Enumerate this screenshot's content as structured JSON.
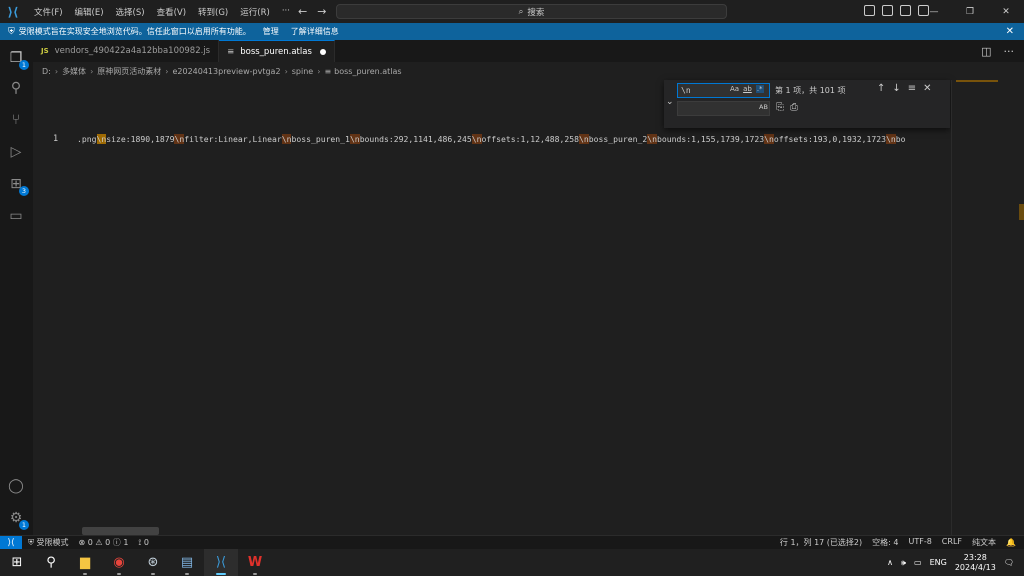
{
  "titlebar": {
    "menu": [
      "文件(F)",
      "编辑(E)",
      "选择(S)",
      "查看(V)",
      "转到(G)",
      "运行(R)",
      "···"
    ],
    "search_placeholder": "搜索"
  },
  "banner": {
    "message": "受限模式旨在实现安全地浏览代码。信任此窗口以启用所有功能。",
    "manage_label": "管理",
    "learn_more_label": "了解详细信息"
  },
  "activity": {
    "explorer_badge": "1",
    "extensions_badge": "3",
    "settings_badge": "1"
  },
  "tabs": [
    {
      "label": "vendors_490422a4a12bba100982.js",
      "type": "JS"
    },
    {
      "label": "boss_puren.atlas",
      "active": true,
      "dirty": true
    }
  ],
  "breadcrumb": [
    "D:",
    "多媒体",
    "原神网页活动素材",
    "e20240413preview-pvtga2",
    "spine",
    "boss_puren.atlas"
  ],
  "editor": {
    "line_number": "1",
    "segments": [
      {
        "t": ".png",
        "h": 0
      },
      {
        "t": "\\n",
        "h": 2
      },
      {
        "t": "size:1890,1879",
        "h": 0
      },
      {
        "t": "\\n",
        "h": 1
      },
      {
        "t": "filter:Linear,Linear",
        "h": 0
      },
      {
        "t": "\\n",
        "h": 1
      },
      {
        "t": "boss_puren_1",
        "h": 0
      },
      {
        "t": "\\n",
        "h": 1
      },
      {
        "t": "bounds:292,1141,486,245",
        "h": 0
      },
      {
        "t": "\\n",
        "h": 1
      },
      {
        "t": "offsets:1,12,488,258",
        "h": 0
      },
      {
        "t": "\\n",
        "h": 1
      },
      {
        "t": "boss_puren_2",
        "h": 0
      },
      {
        "t": "\\n",
        "h": 1
      },
      {
        "t": "bounds:1,155,1739,1723",
        "h": 0
      },
      {
        "t": "\\n",
        "h": 1
      },
      {
        "t": "offsets:193,0,1932,1723",
        "h": 0
      },
      {
        "t": "\\n",
        "h": 1
      },
      {
        "t": "bo",
        "h": 0
      }
    ]
  },
  "find": {
    "query": "\\n",
    "opt_case": "Aa",
    "opt_word": "ab",
    "opt_regex": ".*",
    "preserve_case": "AB",
    "result": "第 1 项，共 101 项"
  },
  "status": {
    "restricted_label": "受限模式",
    "problems": "⊗ 0 ⚠ 0 ⓘ 1",
    "ports": "⟟ 0",
    "cursor": "行 1，列 17 (已选择2)",
    "indent": "空格: 4",
    "encoding": "UTF-8",
    "eol": "CRLF",
    "language": "纯文本"
  },
  "taskbar": {
    "lang": "ENG",
    "time": "23:28",
    "date": "2024/4/13"
  },
  "colors": {
    "accent": "#0078d4",
    "banner": "#0e639c",
    "match_current": "#9e6a03",
    "match_other": "#623315"
  }
}
